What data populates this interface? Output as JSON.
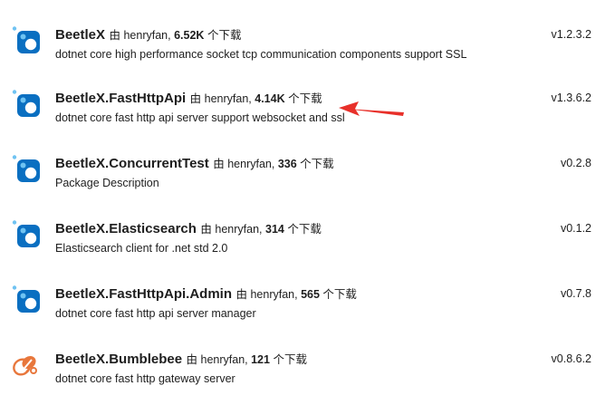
{
  "colors": {
    "nuget_icon_bg": "#0a6fc1",
    "nuget_icon_accent": "#6fc3f2",
    "bumblebee_icon": "#e8773c",
    "annotation_arrow": "#e8302a"
  },
  "packages": [
    {
      "name": "BeetleX",
      "by": "由",
      "author": "henryfan,",
      "downloads": "6.52K",
      "downloads_suffix": "个下载",
      "description": "dotnet core high performance socket tcp communication components support SSL",
      "version": "v1.2.3.2",
      "icon": "nuget-package-icon"
    },
    {
      "name": "BeetleX.FastHttpApi",
      "by": "由",
      "author": "henryfan,",
      "downloads": "4.14K",
      "downloads_suffix": "个下载",
      "description": "dotnet core fast http api server support websocket and ssl",
      "version": "v1.3.6.2",
      "icon": "nuget-package-icon"
    },
    {
      "name": "BeetleX.ConcurrentTest",
      "by": "由",
      "author": "henryfan,",
      "downloads": "336",
      "downloads_suffix": "个下载",
      "description": "Package Description",
      "version": "v0.2.8",
      "icon": "nuget-package-icon"
    },
    {
      "name": "BeetleX.Elasticsearch",
      "by": "由",
      "author": "henryfan,",
      "downloads": "314",
      "downloads_suffix": "个下载",
      "description": "Elasticsearch client for .net std 2.0",
      "version": "v0.1.2",
      "icon": "nuget-package-icon"
    },
    {
      "name": "BeetleX.FastHttpApi.Admin",
      "by": "由",
      "author": "henryfan,",
      "downloads": "565",
      "downloads_suffix": "个下载",
      "description": "dotnet core fast http api server manager",
      "version": "v0.7.8",
      "icon": "nuget-package-icon"
    },
    {
      "name": "BeetleX.Bumblebee",
      "by": "由",
      "author": "henryfan,",
      "downloads": "121",
      "downloads_suffix": "个下载",
      "description": "dotnet core fast http gateway server",
      "version": "v0.8.6.2",
      "icon": "bumblebee-icon"
    }
  ]
}
